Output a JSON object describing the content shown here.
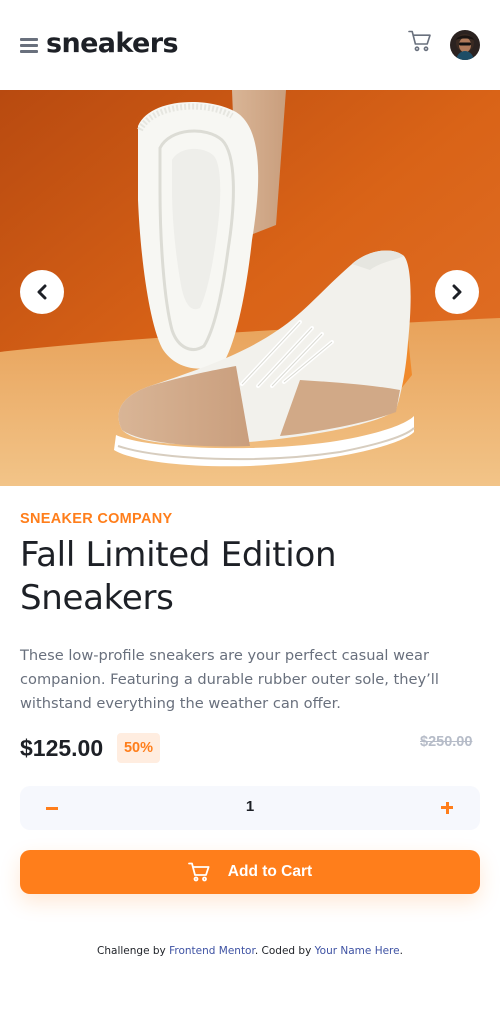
{
  "header": {
    "logo": "sneakers",
    "menu_icon": "hamburger-menu-icon",
    "cart_icon": "cart-icon",
    "avatar_icon": "user-avatar"
  },
  "gallery": {
    "prev_icon": "chevron-left-icon",
    "next_icon": "chevron-right-icon"
  },
  "product": {
    "company": "SNEAKER COMPANY",
    "title": "Fall Limited Edition Sneakers",
    "description": "These low-profile sneakers are your perfect casual wear companion. Featuring a durable rubber outer sole, they’ll withstand everything the weather can offer.",
    "price": "$125.00",
    "discount": "50%",
    "original_price": "$250.00"
  },
  "quantity": {
    "value": "1",
    "minus_icon": "minus-icon",
    "plus_icon": "plus-icon"
  },
  "cart": {
    "add_label": "Add to Cart",
    "add_icon": "cart-icon"
  },
  "attribution": {
    "prefix": "Challenge by ",
    "link1": "Frontend Mentor",
    "middle": ". Coded by ",
    "link2": "Your Name Here",
    "suffix": "."
  },
  "colors": {
    "accent": "#ff7e1b",
    "accent_pale": "#ffede0",
    "text_dark": "#1d2026",
    "text_gray": "#69707d",
    "muted": "#b6bcc8",
    "panel": "#f6f8fd"
  }
}
